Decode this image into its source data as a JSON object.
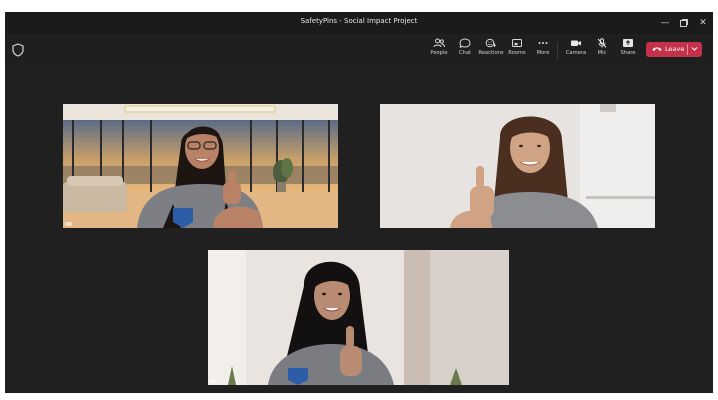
{
  "window": {
    "title": "SafetyPins - Social Impact Project",
    "controls": [
      "minimize-icon",
      "restore-icon",
      "close-icon"
    ]
  },
  "toolbar": {
    "people": {
      "label": "People",
      "icon": "people-icon"
    },
    "chat": {
      "label": "Chat",
      "icon": "chat-icon"
    },
    "reactions": {
      "label": "Reactions",
      "icon": "reactions-icon"
    },
    "rooms": {
      "label": "Rooms",
      "icon": "rooms-icon"
    },
    "more": {
      "label": "More",
      "icon": "more-icon"
    },
    "camera": {
      "label": "Camera",
      "icon": "camera-icon"
    },
    "mic": {
      "label": "Mic",
      "icon": "mic-off-icon"
    },
    "share": {
      "label": "Share",
      "icon": "share-icon"
    },
    "leave": {
      "label": "Leave",
      "color": "#c4314b"
    }
  },
  "participants": [
    {
      "tile": "top-left",
      "background": "virtual-room"
    },
    {
      "tile": "top-right",
      "background": "plain-wall"
    },
    {
      "tile": "bottom-center",
      "background": "plain-wall"
    }
  ],
  "colors": {
    "window": "#1f1f1f",
    "accent": "#c4314b"
  }
}
